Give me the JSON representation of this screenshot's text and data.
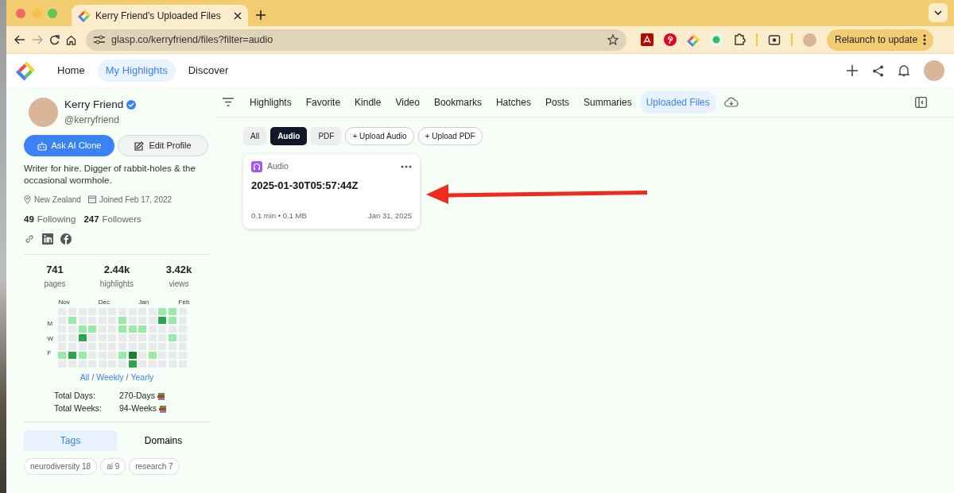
{
  "browser": {
    "tab_title": "Kerry Friend's Uploaded Files",
    "url": "glasp.co/kerryfriend/files?filter=audio",
    "relaunch_button": "Relaunch to update"
  },
  "app_nav": [
    {
      "label": "Home",
      "selected": false
    },
    {
      "label": "My Highlights",
      "selected": true
    },
    {
      "label": "Discover",
      "selected": false
    }
  ],
  "profile": {
    "name": "Kerry Friend",
    "verified": true,
    "handle": "@kerryfriend",
    "buttons": [
      {
        "label": "Ask AI Clone",
        "kind": "primary"
      },
      {
        "label": "Edit Profile",
        "kind": "secondary"
      }
    ],
    "bio": "Writer for hire. Digger of rabbit-holes & the occasional wormhole.",
    "location": "New Zealand",
    "joined": "Joined Feb 17, 2022",
    "following_count": "49",
    "following_label": "Following",
    "followers_count": "247",
    "followers_label": "Followers"
  },
  "stats": [
    {
      "value": "741",
      "label": "pages"
    },
    {
      "value": "2.44k",
      "label": "highlights"
    },
    {
      "value": "3.42k",
      "label": "views"
    }
  ],
  "heatmap": {
    "months": [
      {
        "label": "Nov"
      },
      {
        "label": "Dec"
      },
      {
        "label": "Jan"
      },
      {
        "label": "Feb"
      }
    ],
    "weekdays": [
      {
        "label": "M"
      },
      {
        "label": "W"
      },
      {
        "label": "F"
      }
    ],
    "rows": [
      {
        "cells": [
          {
            "color": "#e8eaec"
          },
          {
            "color": "#e8eaec"
          },
          {
            "color": "#e8eaec"
          },
          {
            "color": "#e8eaec"
          },
          {
            "color": "#e8eaec"
          },
          {
            "color": "#e8eaec"
          },
          {
            "color": "#e8eaec"
          },
          {
            "color": "#e8eaec"
          },
          {
            "color": "#e8eaec"
          },
          {
            "color": "#e8eaec"
          },
          {
            "color": "#9be9a8"
          },
          {
            "color": "#9be9a8"
          },
          {
            "color": "#e8eaec"
          }
        ]
      },
      {
        "cells": [
          {
            "color": "#e8eaec"
          },
          {
            "color": "#9be9a8"
          },
          {
            "color": "#e8eaec"
          },
          {
            "color": "#e8eaec"
          },
          {
            "color": "#e8eaec"
          },
          {
            "color": "#e8eaec"
          },
          {
            "color": "#9be9a8"
          },
          {
            "color": "#e8eaec"
          },
          {
            "color": "#e8eaec"
          },
          {
            "color": "#e8eaec"
          },
          {
            "color": "#2ea44f"
          },
          {
            "color": "#9be9a8"
          },
          {
            "color": "#e8eaec"
          }
        ]
      },
      {
        "cells": [
          {
            "color": "#e8eaec"
          },
          {
            "color": "#e8eaec"
          },
          {
            "color": "#9be9a8"
          },
          {
            "color": "#9be9a8"
          },
          {
            "color": "#e8eaec"
          },
          {
            "color": "#e8eaec"
          },
          {
            "color": "#9be9a8"
          },
          {
            "color": "#9be9a8"
          },
          {
            "color": "#9be9a8"
          },
          {
            "color": "#e8eaec"
          },
          {
            "color": "#e8eaec"
          },
          {
            "color": "#e8eaec"
          },
          {
            "color": "#e8eaec"
          }
        ]
      },
      {
        "cells": [
          {
            "color": "#e8eaec"
          },
          {
            "color": "#e8eaec"
          },
          {
            "color": "#2ea44f"
          },
          {
            "color": "#e8eaec"
          },
          {
            "color": "#e8eaec"
          },
          {
            "color": "#e8eaec"
          },
          {
            "color": "#e8eaec"
          },
          {
            "color": "#e8eaec"
          },
          {
            "color": "#e8eaec"
          },
          {
            "color": "#e8eaec"
          },
          {
            "color": "#e8eaec"
          },
          {
            "color": "#9be9a8"
          },
          {
            "color": "#e8eaec"
          }
        ]
      },
      {
        "cells": [
          {
            "color": "#e8eaec"
          },
          {
            "color": "#e8eaec"
          },
          {
            "color": "#e8eaec"
          },
          {
            "color": "#e8eaec"
          },
          {
            "color": "#e8eaec"
          },
          {
            "color": "#e8eaec"
          },
          {
            "color": "#e8eaec"
          },
          {
            "color": "#e8eaec"
          },
          {
            "color": "#e8eaec"
          },
          {
            "color": "#e8eaec"
          },
          {
            "color": "#e8eaec"
          },
          {
            "color": "#e8eaec"
          },
          {
            "color": "#e8eaec"
          }
        ]
      },
      {
        "cells": [
          {
            "color": "#9be9a8"
          },
          {
            "color": "#2ea44f"
          },
          {
            "color": "#9be9a8"
          },
          {
            "color": "#e8eaec"
          },
          {
            "color": "#e8eaec"
          },
          {
            "color": "#e8eaec"
          },
          {
            "color": "#9be9a8"
          },
          {
            "color": "#1a7f37"
          },
          {
            "color": "#e8eaec"
          },
          {
            "color": "#9be9a8"
          },
          {
            "color": "#e8eaec"
          },
          {
            "color": "#e8eaec"
          },
          {
            "color": "#e8eaec"
          }
        ]
      },
      {
        "cells": [
          {
            "color": "#e8eaec"
          },
          {
            "color": "#e8eaec"
          },
          {
            "color": "#e8eaec"
          },
          {
            "color": "#e8eaec"
          },
          {
            "color": "#e8eaec"
          },
          {
            "color": "#e8eaec"
          },
          {
            "color": "#e8eaec"
          },
          {
            "color": "#2ea44f"
          },
          {
            "color": "#e8eaec"
          },
          {
            "color": "#e8eaec"
          },
          {
            "color": "#e8eaec"
          },
          {
            "color": "#e8eaec"
          },
          {
            "color": "#e8eaec"
          }
        ]
      }
    ],
    "views": [
      {
        "label": "All"
      },
      {
        "label": "Weekly"
      },
      {
        "label": "Yearly"
      }
    ],
    "separator": "/"
  },
  "totals": [
    {
      "label": "Total Days:",
      "value": "270-Days"
    },
    {
      "label": "Total Weeks:",
      "value": "94-Weeks"
    }
  ],
  "sidebar_tabs": [
    {
      "label": "Tags",
      "selected": true
    },
    {
      "label": "Domains",
      "selected": false
    }
  ],
  "tags": [
    {
      "label": "neurodiversity 18"
    },
    {
      "label": "ai 9"
    },
    {
      "label": "research 7"
    }
  ],
  "content_tabs": [
    {
      "label": "Highlights",
      "selected": false
    },
    {
      "label": "Favorite",
      "selected": false
    },
    {
      "label": "Kindle",
      "selected": false
    },
    {
      "label": "Video",
      "selected": false
    },
    {
      "label": "Bookmarks",
      "selected": false
    },
    {
      "label": "Hatches",
      "selected": false
    },
    {
      "label": "Posts",
      "selected": false
    },
    {
      "label": "Summaries",
      "selected": false
    },
    {
      "label": "Uploaded Files",
      "selected": true
    }
  ],
  "filters": [
    {
      "label": "All",
      "kind": "filter",
      "selected": false
    },
    {
      "label": "Audio",
      "kind": "filter",
      "selected": true
    },
    {
      "label": "PDF",
      "kind": "filter",
      "selected": false
    },
    {
      "label": "+ Upload Audio",
      "kind": "upload",
      "selected": false
    },
    {
      "label": "+ Upload PDF",
      "kind": "upload",
      "selected": false
    }
  ],
  "files": [
    {
      "type": "Audio",
      "title": "2025-01-30T05:57:44Z",
      "meta": "0.1 min • 0.1 MB",
      "date": "Jan 31, 2025"
    }
  ],
  "annotation": {
    "kind": "arrow"
  }
}
